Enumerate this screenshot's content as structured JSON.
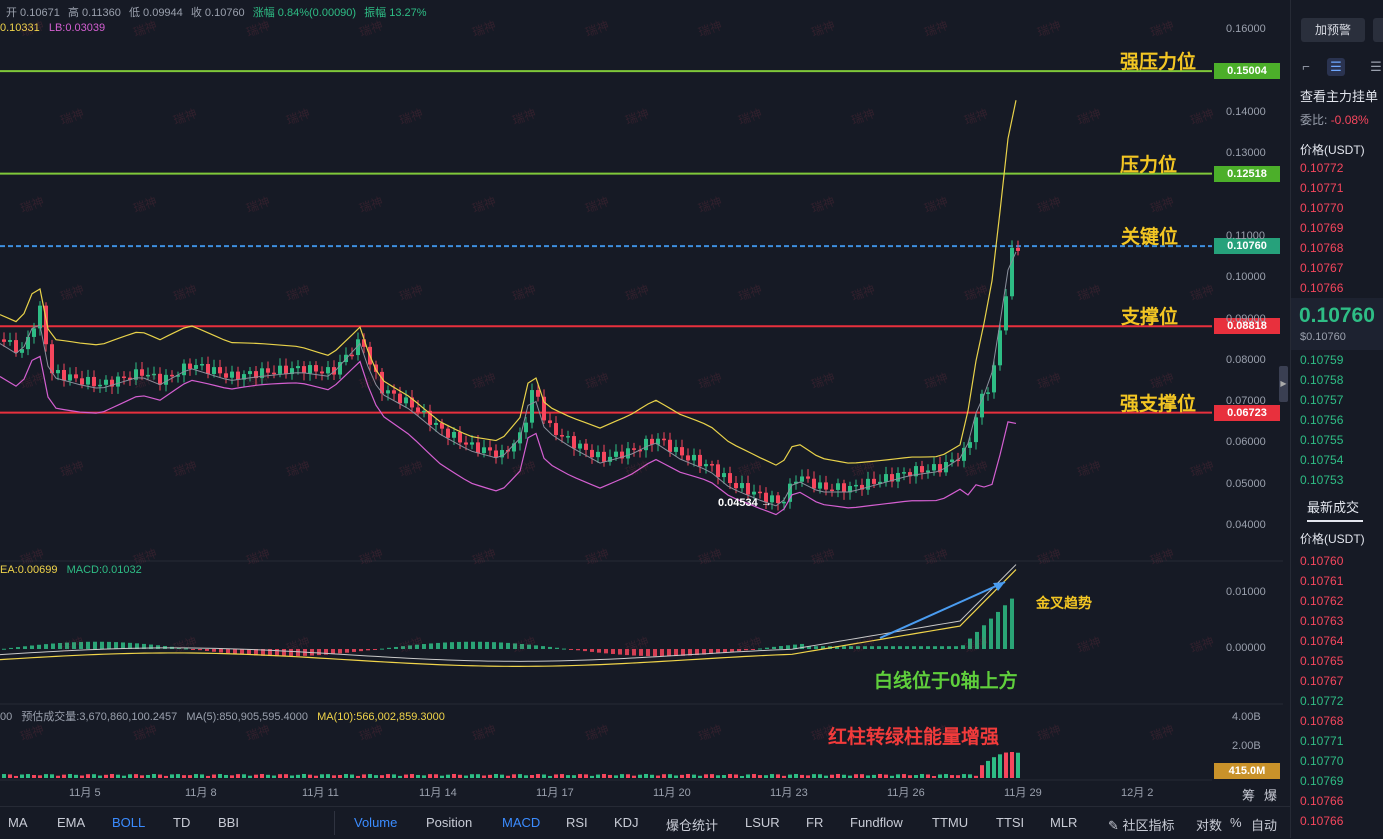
{
  "ohlc": {
    "open": "开 0.10671",
    "high": "高 0.11360",
    "low": "低 0.09944",
    "close": "收 0.10760",
    "change": "涨幅 0.84%(0.00090)",
    "amplitude": "振幅 13.27%"
  },
  "boll_legend": {
    "mb": "0.10331",
    "lb": "LB:0.03039"
  },
  "macd_legend": {
    "dea": "EA:0.00699",
    "macd": "MACD:0.01032"
  },
  "vol_legend": {
    "prefix": "00",
    "forecast": "预估成交量:3,670,860,100.2457",
    "ma5": "MA(5):850,905,595.4000",
    "ma10": "MA(10):566,002,859.3000"
  },
  "levels": [
    {
      "label": "强压力位",
      "price": 0.15004,
      "tag": "0.15004",
      "color": "#7fc83a",
      "tag_color": "#4caf2a"
    },
    {
      "label": "压力位",
      "price": 0.12518,
      "tag": "0.12518",
      "color": "#7fc83a",
      "tag_color": "#4caf2a"
    },
    {
      "label": "关键位",
      "price": 0.1076,
      "tag": "0.10760",
      "color": "#3d8fe0",
      "tag_color": "#26a17b"
    },
    {
      "label": "支撑位",
      "price": 0.08818,
      "tag": "0.08818",
      "color": "#e8303d",
      "tag_color": "#e8303d"
    },
    {
      "label": "强支撑位",
      "price": 0.06723,
      "tag": "0.06723",
      "color": "#e8303d",
      "tag_color": "#e8303d"
    }
  ],
  "annotations": {
    "golden_cross": "金叉趋势",
    "white_line": "白线位于0轴上方",
    "red_to_green": "红柱转绿柱能量增强",
    "low_mark": "0.04534"
  },
  "price_axis": [
    "0.16000",
    "0.14000",
    "0.13000",
    "0.11000",
    "0.10000",
    "0.09000",
    "0.08000",
    "0.07000",
    "0.06000",
    "0.05000",
    "0.04000"
  ],
  "macd_axis": [
    "0.01000",
    "0.00000"
  ],
  "vol_axis": [
    "4.00B",
    "2.00B"
  ],
  "vol_tag": "415.0M",
  "x_labels": [
    "11月 5",
    "11月 8",
    "11月 11",
    "11月 14",
    "11月 17",
    "11月 20",
    "11月 23",
    "11月 26",
    "11月 29",
    "12月 2"
  ],
  "toolbar": {
    "left": [
      "MA",
      "EMA",
      "BOLL",
      "TD",
      "BBI"
    ],
    "right": [
      "Volume",
      "Position",
      "MACD",
      "RSI",
      "KDJ",
      "爆仓统计",
      "LSUR",
      "FR",
      "Fundflow",
      "TTMU",
      "TTSI",
      "MLR"
    ],
    "community": "社区指标",
    "log": "对数",
    "pct": "%",
    "auto": "自动",
    "corner1": "筹",
    "corner2": "爆"
  },
  "side": {
    "alert_btn": "加预警",
    "main_orders": "查看主力挂单",
    "ratio_label": "委比:",
    "ratio_value": "-0.08%",
    "price_header": "价格(USDT)",
    "asks": [
      "0.10772",
      "0.10771",
      "0.10770",
      "0.10769",
      "0.10768",
      "0.10767",
      "0.10766"
    ],
    "last_price": "0.10760",
    "last_price_sub": "$0.10760",
    "bids": [
      "0.10759",
      "0.10758",
      "0.10757",
      "0.10756",
      "0.10755",
      "0.10754",
      "0.10753"
    ],
    "trades_title": "最新成交",
    "trades_header": "价格(USDT)",
    "trades": [
      {
        "p": "0.10760",
        "c": "red"
      },
      {
        "p": "0.10761",
        "c": "red"
      },
      {
        "p": "0.10762",
        "c": "red"
      },
      {
        "p": "0.10763",
        "c": "red"
      },
      {
        "p": "0.10764",
        "c": "red"
      },
      {
        "p": "0.10765",
        "c": "red"
      },
      {
        "p": "0.10767",
        "c": "red"
      },
      {
        "p": "0.10772",
        "c": "green"
      },
      {
        "p": "0.10768",
        "c": "red"
      },
      {
        "p": "0.10771",
        "c": "green"
      },
      {
        "p": "0.10770",
        "c": "green"
      },
      {
        "p": "0.10769",
        "c": "green"
      },
      {
        "p": "0.10766",
        "c": "red"
      },
      {
        "p": "0.10766",
        "c": "red"
      }
    ]
  },
  "watermark": "瑞神"
}
